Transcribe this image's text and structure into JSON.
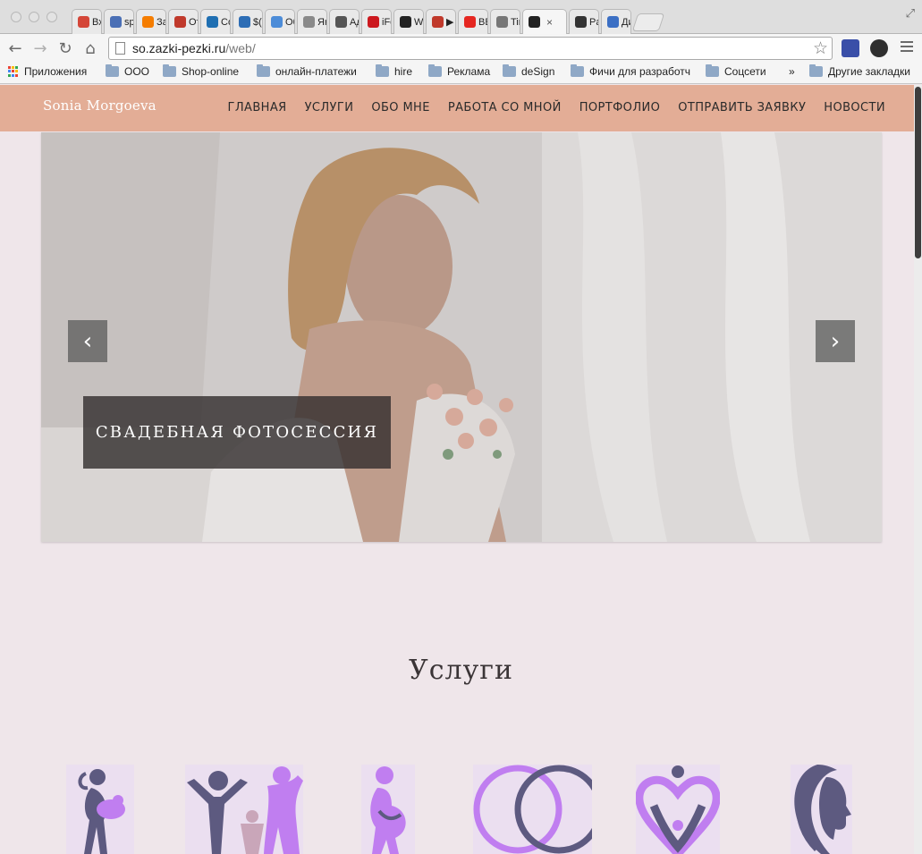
{
  "browser": {
    "tabs": [
      {
        "label": "Вхо",
        "icon": "gmail-icon",
        "color": "#d44638"
      },
      {
        "label": "spy",
        "icon": "user-icon",
        "color": "#4a6fb5"
      },
      {
        "label": "Зап",
        "icon": "blogger-icon",
        "color": "#f57d00"
      },
      {
        "label": "Отп",
        "icon": "mail-bird-icon",
        "color": "#c0392b"
      },
      {
        "label": "Col",
        "icon": "cloud-app-icon",
        "color": "#1f6fb2"
      },
      {
        "label": "$( c",
        "icon": "jquery-icon",
        "color": "#2d6db5"
      },
      {
        "label": "Обл",
        "icon": "cloud-icon",
        "color": "#4c8cd8"
      },
      {
        "label": "Янд",
        "icon": "doc-icon",
        "color": "#8a8a8a"
      },
      {
        "label": "Адм",
        "icon": "admin-icon",
        "color": "#555555"
      },
      {
        "label": "iFor",
        "icon": "youtube-icon",
        "color": "#cc181e"
      },
      {
        "label": "Wel",
        "icon": "symfony-icon",
        "color": "#222222"
      },
      {
        "label": "▶ L",
        "icon": "star-video-icon",
        "color": "#c0392b"
      },
      {
        "label": "BBC",
        "icon": "yandex-icon",
        "color": "#e52620"
      },
      {
        "label": "Tiny",
        "icon": "tinymce-icon",
        "color": "#777777"
      },
      {
        "label": "",
        "icon": "symfony-icon",
        "color": "#222222",
        "active": true,
        "close": "×"
      },
      {
        "label": "Pale",
        "icon": "hearts-icon",
        "color": "#333333"
      },
      {
        "label": "Диа",
        "icon": "chat-icon",
        "color": "#3b6fc4"
      }
    ],
    "url_host": "so.zazki-pezki.ru",
    "url_path": "/web/",
    "bookmarks": {
      "apps": "Приложения",
      "folders": [
        "ООО",
        "Shop-online",
        "онлайн-платежи",
        "hire",
        "Реклама",
        "deSign",
        "Фичи для разработч",
        "Соцсети"
      ],
      "overflow": "»",
      "other": "Другие закладки"
    }
  },
  "site": {
    "logo": "Sonia Morgoeva",
    "nav": [
      "ГЛАВНАЯ",
      "УСЛУГИ",
      "ОБО МНЕ",
      "РАБОТА СО МНОЙ",
      "ПОРТФОЛИО",
      "ОТПРАВИТЬ ЗАЯВКУ",
      "НОВОСТИ"
    ],
    "slider": {
      "caption": "СВАДЕБНАЯ ФОТОСЕССИЯ",
      "prev_icon": "chevron-left-icon",
      "next_icon": "chevron-right-icon"
    },
    "services_title": "Услуги",
    "services_icons": [
      "mother-baby-icon",
      "family-icon",
      "pregnant-icon",
      "wedding-rings-icon",
      "heart-family-icon",
      "woman-profile-icon"
    ]
  },
  "colors": {
    "header": "#e3ad96",
    "page_bg": "#efe6ea",
    "icon_purple": "#c07ef0",
    "icon_slate": "#5d5a80"
  }
}
